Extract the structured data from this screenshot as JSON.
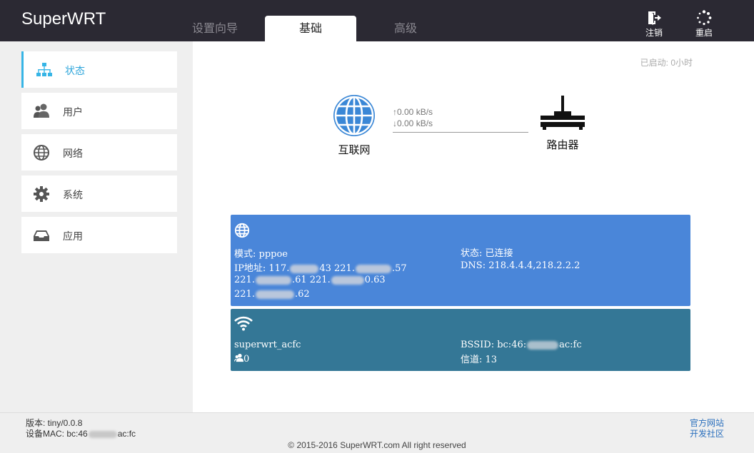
{
  "header": {
    "brand": "SuperWRT",
    "tabs": [
      {
        "label": "设置向导",
        "active": false
      },
      {
        "label": "基础",
        "active": true
      },
      {
        "label": "高级",
        "active": false
      }
    ],
    "tools": {
      "logout": {
        "label": "注销",
        "icon": "logout-icon"
      },
      "reboot": {
        "label": "重启",
        "icon": "spinner-icon"
      }
    }
  },
  "sidebar": {
    "accent": "#37b5e6",
    "items": [
      {
        "label": "状态",
        "icon": "sitemap-icon",
        "active": true
      },
      {
        "label": "用户",
        "icon": "users-icon"
      },
      {
        "label": "网络",
        "icon": "globe-icon"
      },
      {
        "label": "系统",
        "icon": "gear-icon"
      },
      {
        "label": "应用",
        "icon": "inbox-icon"
      }
    ]
  },
  "main": {
    "uptime": "已启动: 0小时",
    "topology": {
      "internet_label": "互联网",
      "router_label": "路由器",
      "upload": "↑0.00 kB/s",
      "download": "↓0.00 kB/s"
    },
    "wan_card": {
      "color": "#4a86d9",
      "icon": "globe-icon",
      "mode": "模式: pppoe",
      "ip_prefix": "IP地址: 117.",
      "ip_1_suffix": "43 221.",
      "ip_2_suffix": ".57",
      "line2_a": "221.",
      "line2_b": ".61 221.",
      "line2_c": "0.63",
      "line3_a": "221.",
      "line3_b": ".62",
      "status": "状态: 已连接",
      "dns": "DNS: 218.4.4.4,218.2.2.2"
    },
    "wifi_card": {
      "color": "#347796",
      "icon": "wifi-icon",
      "ssid": "superwrt_acfc",
      "clients": "0",
      "bssid_prefix": "BSSID: bc:46:",
      "bssid_suffix": "ac:fc",
      "channel": "信道: 13"
    }
  },
  "footer": {
    "version": "版本: tiny/0.0.8",
    "mac_prefix": "设备MAC: bc:46",
    "mac_suffix": "ac:fc",
    "links": [
      "官方网站",
      "开发社区"
    ],
    "copyright": "© 2015-2016 SuperWRT.com All right reserved"
  }
}
